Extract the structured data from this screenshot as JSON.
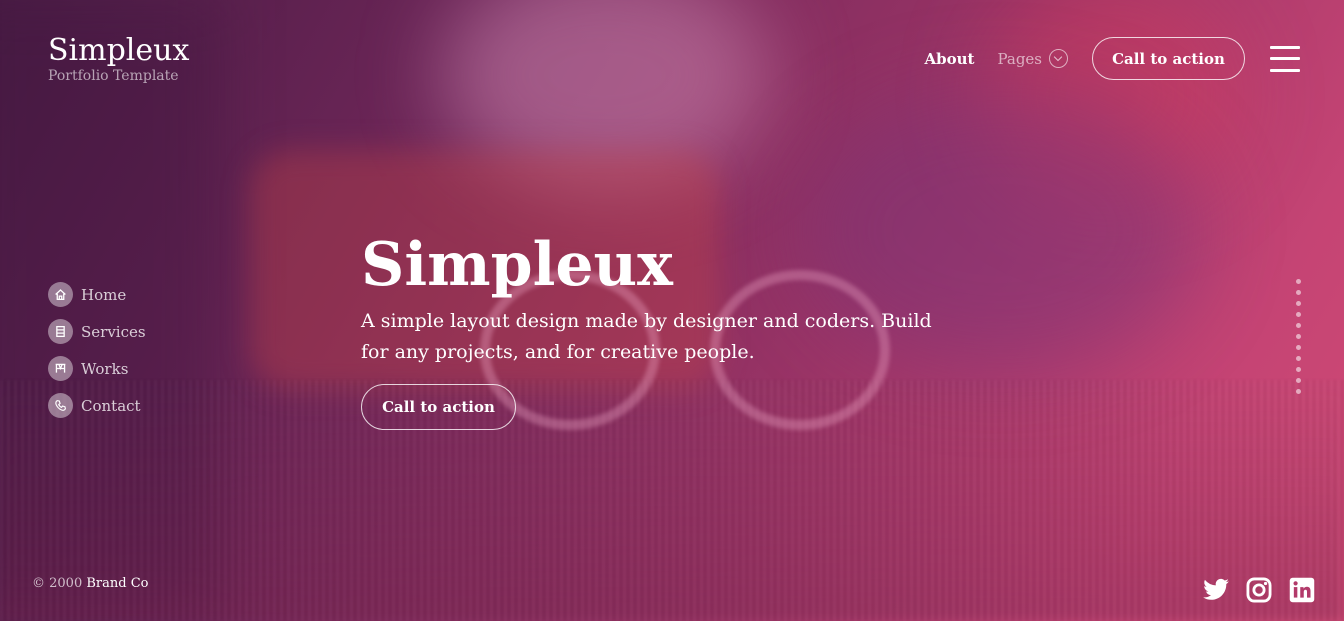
{
  "brand": {
    "title": "Simpleux",
    "subtitle": "Portfolio Template"
  },
  "topnav": {
    "about": "About",
    "pages": "Pages",
    "cta": "Call to action"
  },
  "sidenav": {
    "items": [
      {
        "label": "Home",
        "icon": "home-icon"
      },
      {
        "label": "Services",
        "icon": "services-icon"
      },
      {
        "label": "Works",
        "icon": "works-icon"
      },
      {
        "label": "Contact",
        "icon": "phone-icon"
      }
    ]
  },
  "hero": {
    "title": "Simpleux",
    "text": "A simple layout design made by designer and coders. Build for any projects, and for creative people.",
    "cta": "Call to action"
  },
  "footer": {
    "copyright_prefix": "© 2000",
    "brand": "Brand Co",
    "social": [
      "twitter-icon",
      "instagram-icon",
      "linkedin-icon"
    ]
  },
  "colors": {
    "gradient_start": "#4a1c45",
    "gradient_end": "#d04a75",
    "text": "#ffffff"
  }
}
